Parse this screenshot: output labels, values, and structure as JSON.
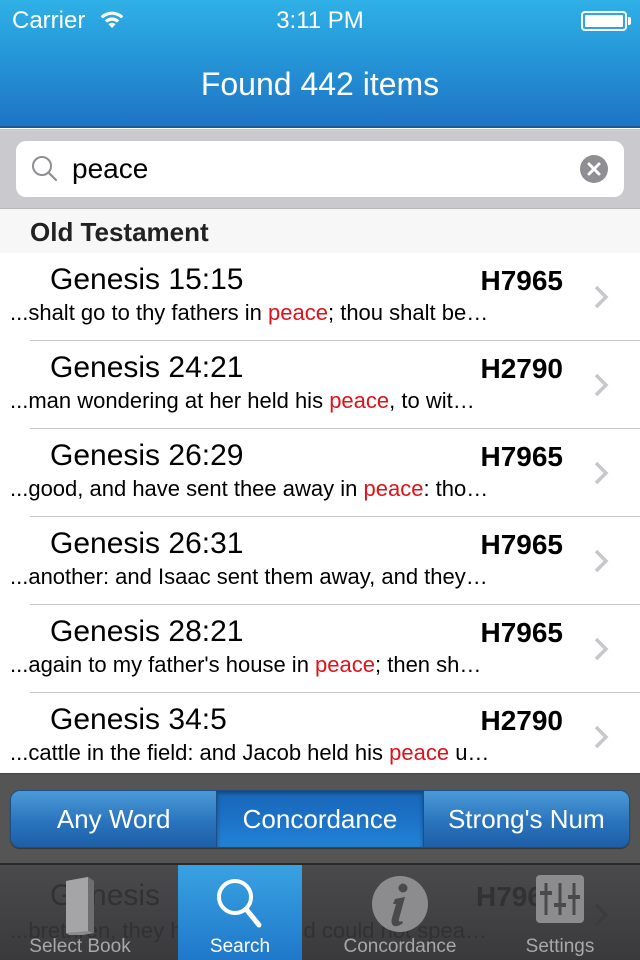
{
  "status_bar": {
    "carrier": "Carrier",
    "time": "3:11 PM",
    "wifi_icon": "wifi-icon",
    "battery_icon": "battery-icon"
  },
  "nav": {
    "title": "Found 442 items"
  },
  "search": {
    "value": "peace",
    "search_icon": "search-icon",
    "clear_icon": "clear-icon"
  },
  "section": {
    "title": "Old Testament"
  },
  "results": [
    {
      "reference": "Genesis 15:15",
      "strongs": "H7965",
      "before": "...shalt go to thy fathers in ",
      "match": "peace",
      "after": "; thou shalt be…"
    },
    {
      "reference": "Genesis 24:21",
      "strongs": "H2790",
      "before": "...man wondering at her held his ",
      "match": "peace",
      "after": ", to wit…"
    },
    {
      "reference": "Genesis 26:29",
      "strongs": "H7965",
      "before": "...good, and have sent thee away in ",
      "match": "peace",
      "after": ": tho…"
    },
    {
      "reference": "Genesis 26:31",
      "strongs": "H7965",
      "before": "...another: and Isaac sent them away, and they…",
      "match": "",
      "after": ""
    },
    {
      "reference": "Genesis 28:21",
      "strongs": "H7965",
      "before": "...again to my father's house in ",
      "match": "peace",
      "after": "; then sh…"
    },
    {
      "reference": "Genesis 34:5",
      "strongs": "H2790",
      "before": "...cattle in the field: and Jacob held his ",
      "match": "peace",
      "after": " u…"
    }
  ],
  "partial_row": {
    "reference": "Genesis",
    "strongs": "H7965",
    "snippet": "...brethren, they hated him, and could not spea…"
  },
  "search_modes": {
    "options": [
      "Any Word",
      "Concordance",
      "Strong's Num"
    ],
    "selected": "Concordance"
  },
  "colors": {
    "accent": "#1f77c9",
    "highlight": "#e0111a"
  },
  "tabs": [
    {
      "label": "Select Book",
      "icon": "book-icon",
      "active": false
    },
    {
      "label": "Search",
      "icon": "search-icon",
      "active": true
    },
    {
      "label": "Concordance",
      "icon": "info-icon",
      "active": false
    },
    {
      "label": "Settings",
      "icon": "sliders-icon",
      "active": false
    }
  ]
}
